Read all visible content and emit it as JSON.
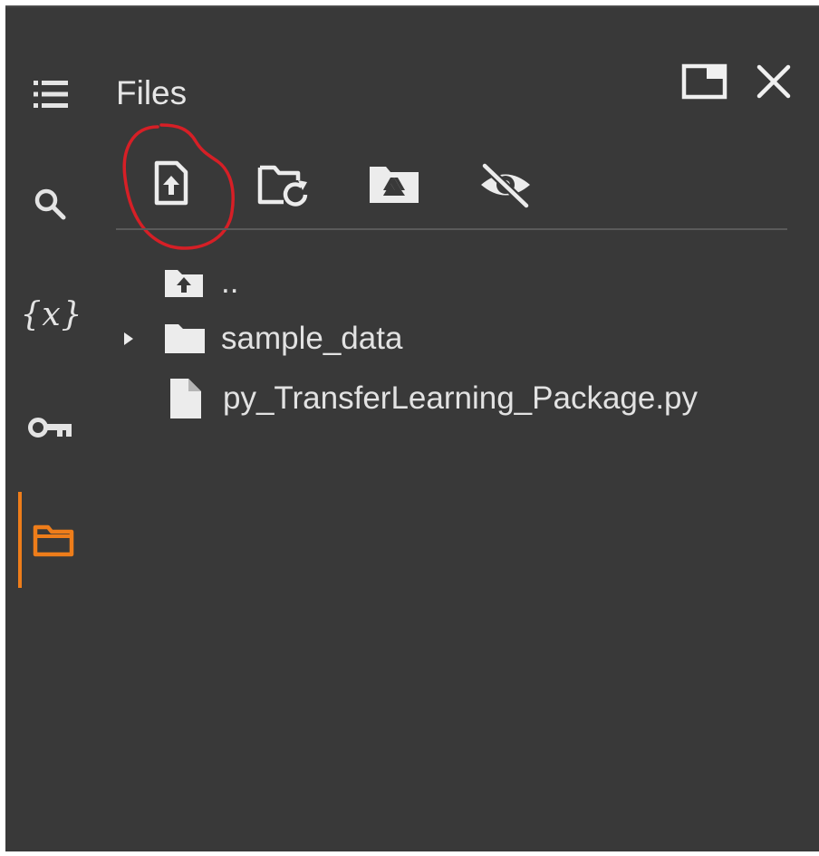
{
  "panel": {
    "title": "Files"
  },
  "rail": {
    "items": [
      {
        "icon": "table-of-contents-icon",
        "active": false
      },
      {
        "icon": "search-icon",
        "active": false
      },
      {
        "icon": "variables-icon",
        "glyph": "{x}",
        "active": false
      },
      {
        "icon": "key-icon",
        "active": false
      },
      {
        "icon": "folder-icon",
        "active": true
      }
    ]
  },
  "toolbar": {
    "items": [
      {
        "icon": "upload-file-icon",
        "tooltip": ""
      },
      {
        "icon": "refresh-folder-icon",
        "tooltip": ""
      },
      {
        "icon": "drive-folder-icon",
        "tooltip": ""
      },
      {
        "icon": "hide-eye-icon",
        "tooltip": ""
      }
    ]
  },
  "tree": {
    "rows": [
      {
        "label": "..",
        "icon": "parent-folder-icon",
        "expandable": false
      },
      {
        "label": "sample_data",
        "icon": "folder-icon",
        "expandable": true
      },
      {
        "label": "py_TransferLearning_Package.py",
        "icon": "file-icon",
        "expandable": false
      }
    ]
  },
  "colors": {
    "background": "#393939",
    "text": "#e2e2e2",
    "accent": "#ee7d1a",
    "annotation": "#d61f26"
  }
}
